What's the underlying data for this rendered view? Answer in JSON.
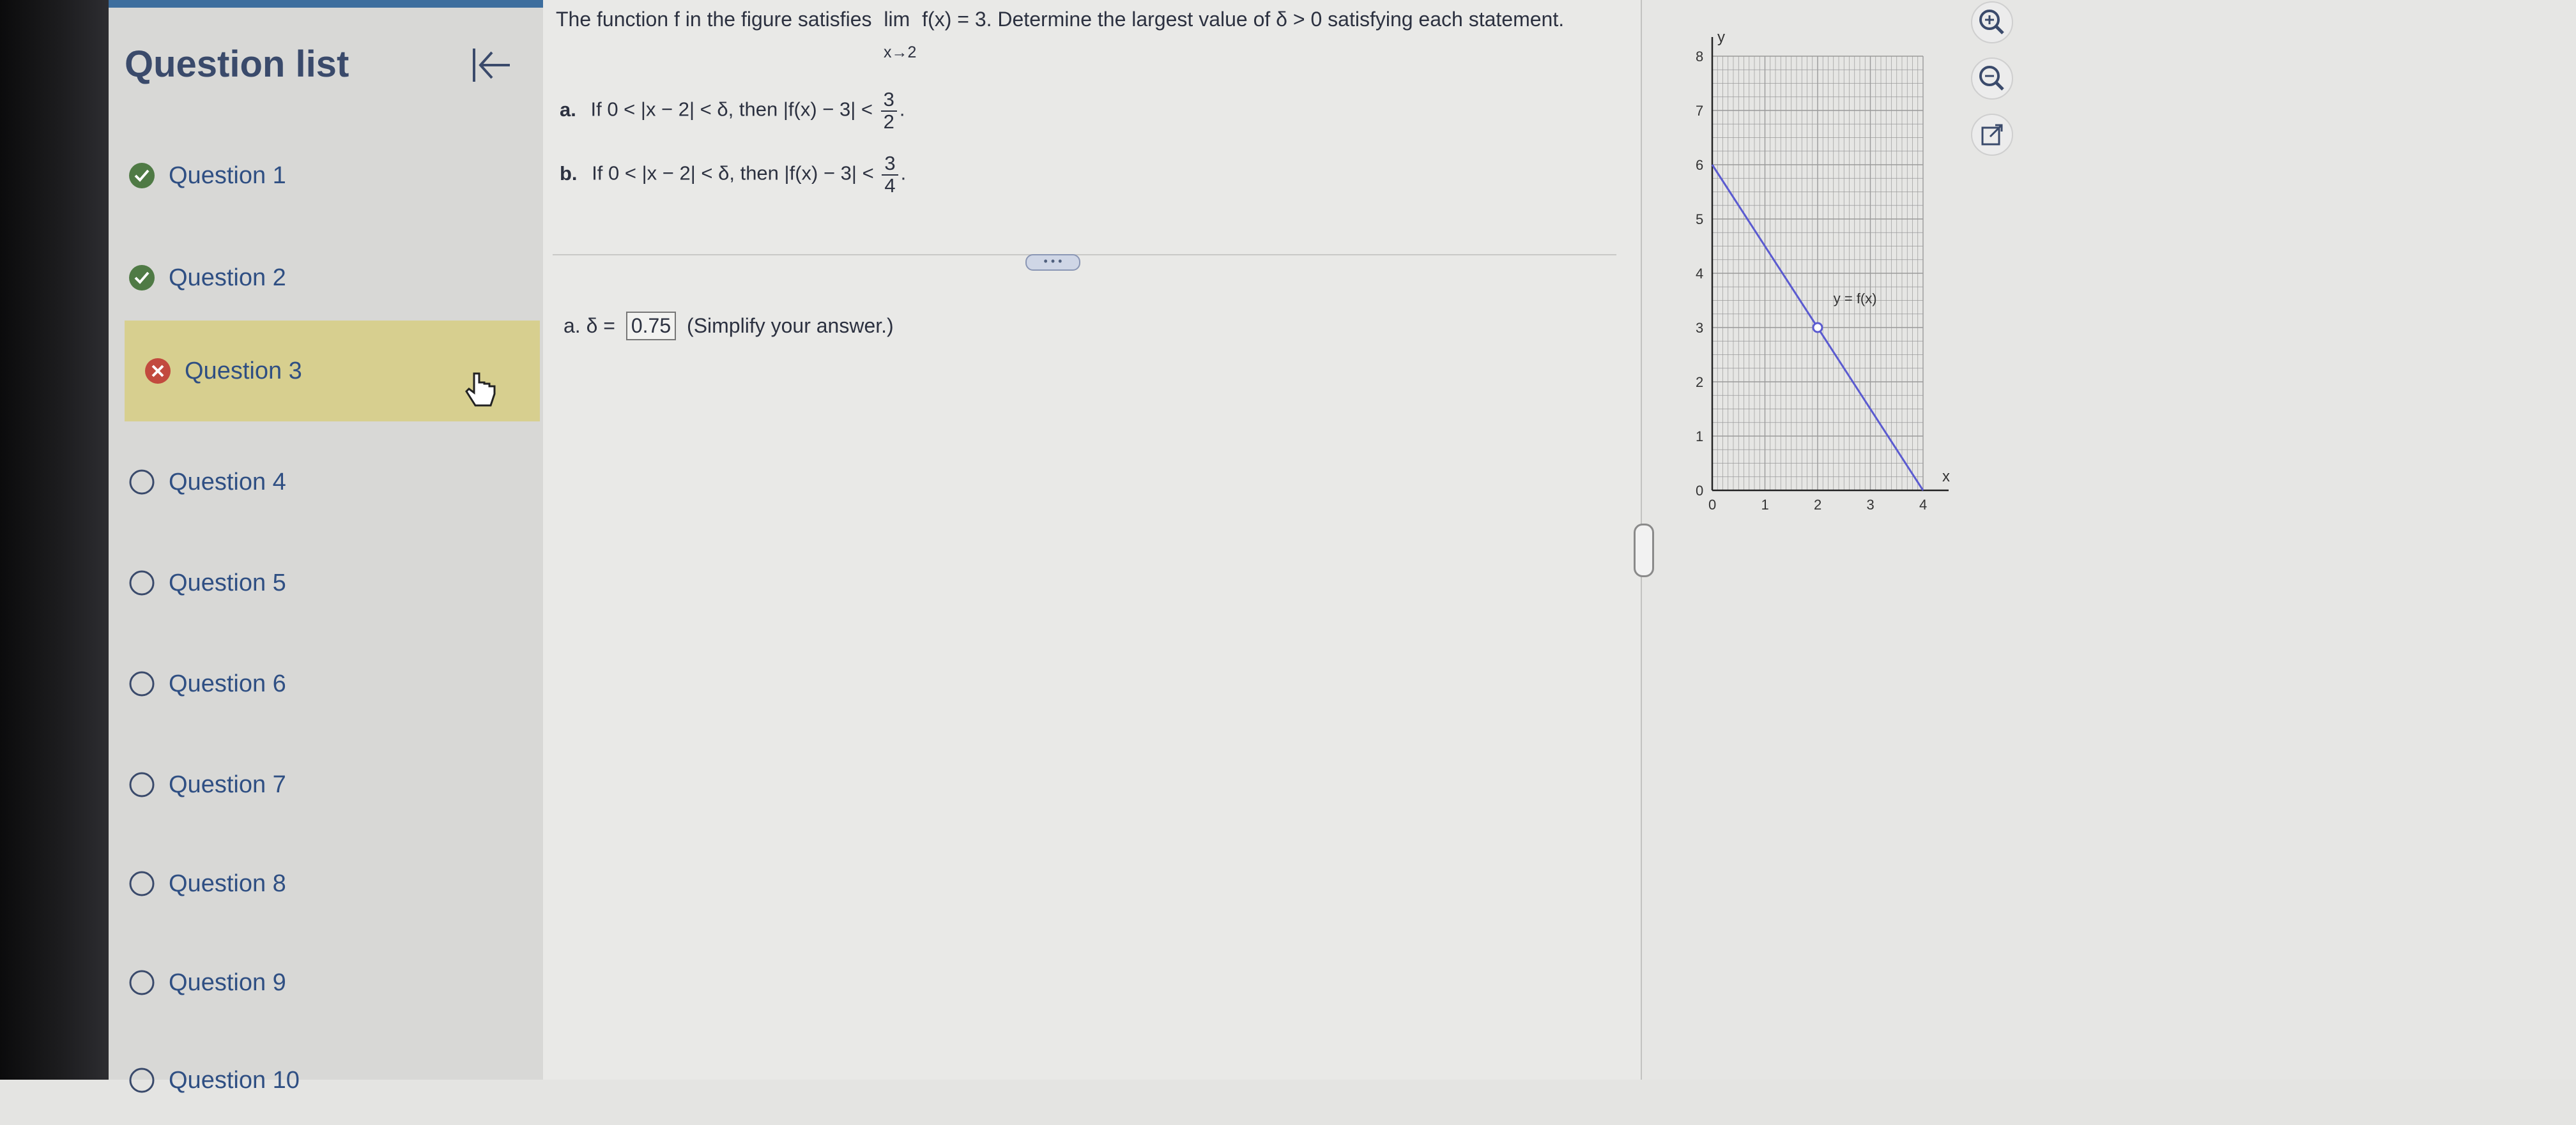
{
  "sidebar": {
    "title": "Question list",
    "collapse_icon": "collapse-left-icon",
    "items": [
      {
        "label": "Question 1",
        "status": "correct"
      },
      {
        "label": "Question 2",
        "status": "correct"
      },
      {
        "label": "Question 3",
        "status": "incorrect"
      },
      {
        "label": "Question 4",
        "status": "unanswered"
      },
      {
        "label": "Question 5",
        "status": "unanswered"
      },
      {
        "label": "Question 6",
        "status": "unanswered"
      },
      {
        "label": "Question 7",
        "status": "unanswered"
      },
      {
        "label": "Question 8",
        "status": "unanswered"
      },
      {
        "label": "Question 9",
        "status": "unanswered"
      },
      {
        "label": "Question 10",
        "status": "unanswered"
      }
    ]
  },
  "question": {
    "prompt_start": "The function f in the figure satisfies",
    "limit": "lim",
    "limit_expr": "f(x) = 3. Determine the largest value of δ > 0 satisfying each statement.",
    "limit_sub": "x→2",
    "part_a": {
      "label": "a.",
      "text": "If 0 < |x − 2| < δ, then |f(x) − 3| <",
      "num": "3",
      "den": "2"
    },
    "part_b": {
      "label": "b.",
      "text": "If 0 < |x − 2| < δ, then |f(x) − 3| <",
      "num": "3",
      "den": "4"
    },
    "divider_handle": "• • •"
  },
  "answer": {
    "prefix": "a. δ =",
    "value": "0.75",
    "hint": "(Simplify your answer.)"
  },
  "graph": {
    "y_axis_label": "y",
    "x_axis_label": "x",
    "curve_label": "y = f(x)",
    "x_ticks": [
      "0",
      "1",
      "2",
      "3",
      "4"
    ],
    "y_ticks": [
      "0",
      "1",
      "2",
      "3",
      "4",
      "5",
      "6",
      "7",
      "8"
    ],
    "line_from": [
      0,
      6
    ],
    "line_to": [
      4,
      0
    ],
    "hole_at": [
      2,
      3
    ]
  },
  "tools": [
    "zoom-in-icon",
    "zoom-out-icon",
    "external-link-icon"
  ],
  "colors": {
    "accent": "#3d6e9e",
    "active_row": "#d7cf8f",
    "correct": "#4f7a45",
    "incorrect": "#c24a3e",
    "graph_line": "#5b5bd0"
  }
}
